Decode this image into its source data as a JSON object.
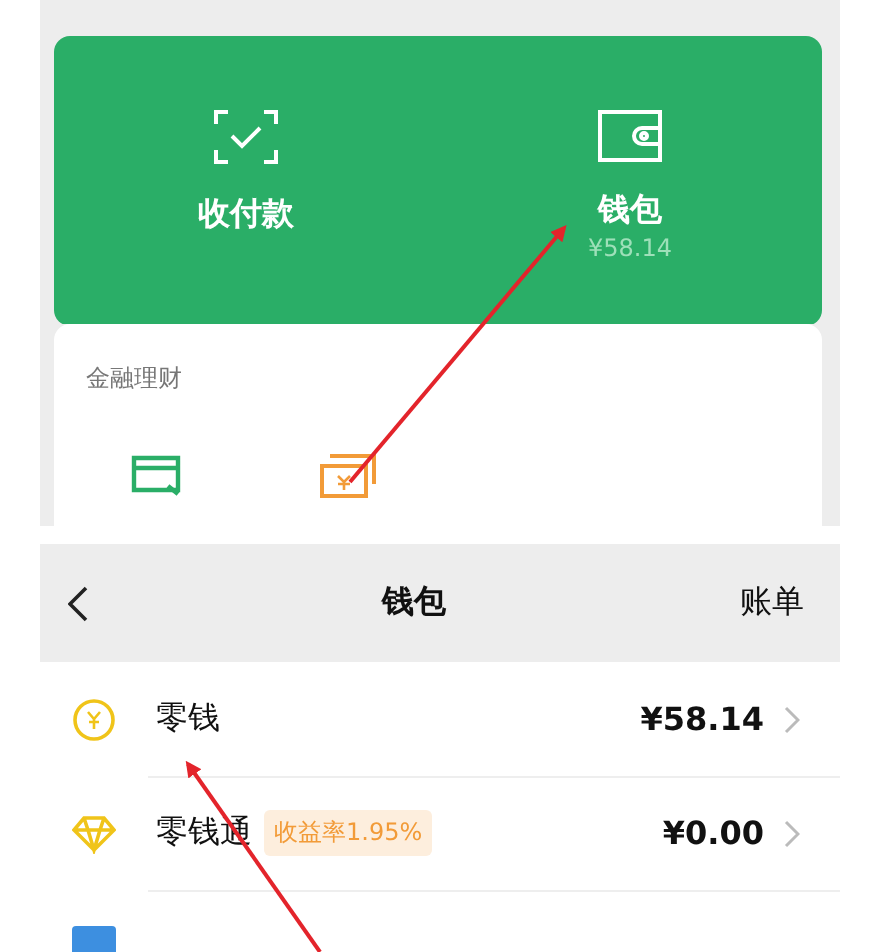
{
  "pay_panel": {
    "actions": [
      {
        "kind": "scan",
        "label": "收付款"
      },
      {
        "kind": "wallet",
        "label": "钱包",
        "balance": "¥58.14"
      }
    ]
  },
  "finance": {
    "title": "金融理财",
    "items": [
      {
        "kind": "card"
      },
      {
        "kind": "cash"
      }
    ]
  },
  "wallet": {
    "title": "钱包",
    "action": "账单",
    "rows": [
      {
        "kind": "coin",
        "label": "零钱",
        "amount": "¥58.14"
      },
      {
        "kind": "diamond",
        "label": "零钱通",
        "badge": "收益率1.95%",
        "amount": "¥0.00"
      },
      {
        "kind": "bank"
      }
    ]
  }
}
